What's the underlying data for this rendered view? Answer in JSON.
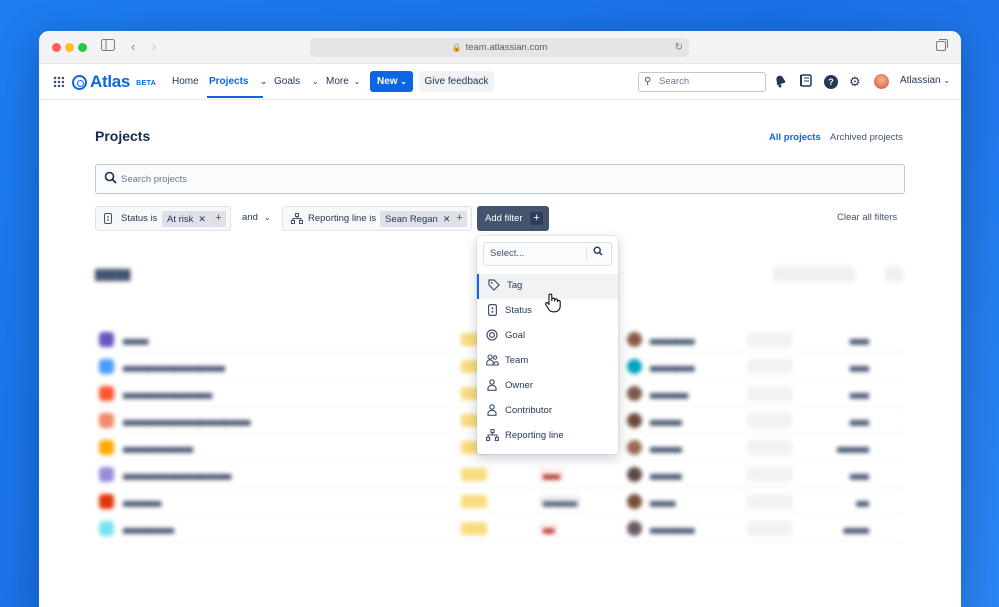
{
  "browser": {
    "url": "team.atlassian.com"
  },
  "nav": {
    "brand": "Atlas",
    "badge": "BETA",
    "items": [
      {
        "label": "Home"
      },
      {
        "label": "Projects"
      },
      {
        "label": "Goals"
      },
      {
        "label": "More"
      }
    ],
    "new_label": "New",
    "feedback_label": "Give feedback",
    "search_placeholder": "Search",
    "org_label": "Atlassian"
  },
  "page": {
    "title": "Projects",
    "tabs": [
      {
        "label": "All projects"
      },
      {
        "label": "Archived projects"
      }
    ],
    "search_placeholder": "Search projects"
  },
  "filters": {
    "status_label": "Status is",
    "status_value": "At risk",
    "connector": "and",
    "reporting_label": "Reporting line is",
    "reporting_value": "Sean Regan",
    "add_filter_label": "Add filter",
    "clear_label": "Clear all filters"
  },
  "dropdown": {
    "placeholder": "Select...",
    "options": [
      {
        "label": "Tag",
        "icon": "tag-icon"
      },
      {
        "label": "Status",
        "icon": "status-icon"
      },
      {
        "label": "Goal",
        "icon": "goal-icon"
      },
      {
        "label": "Team",
        "icon": "team-icon"
      },
      {
        "label": "Owner",
        "icon": "owner-icon"
      },
      {
        "label": "Contributor",
        "icon": "contributor-icon"
      },
      {
        "label": "Reporting line",
        "icon": "reporting-line-icon"
      }
    ],
    "highlighted": "Tag"
  },
  "colors": {
    "accent": "#0c66e4",
    "background": "#1c7cf0",
    "add_filter_bg": "#44546f"
  }
}
